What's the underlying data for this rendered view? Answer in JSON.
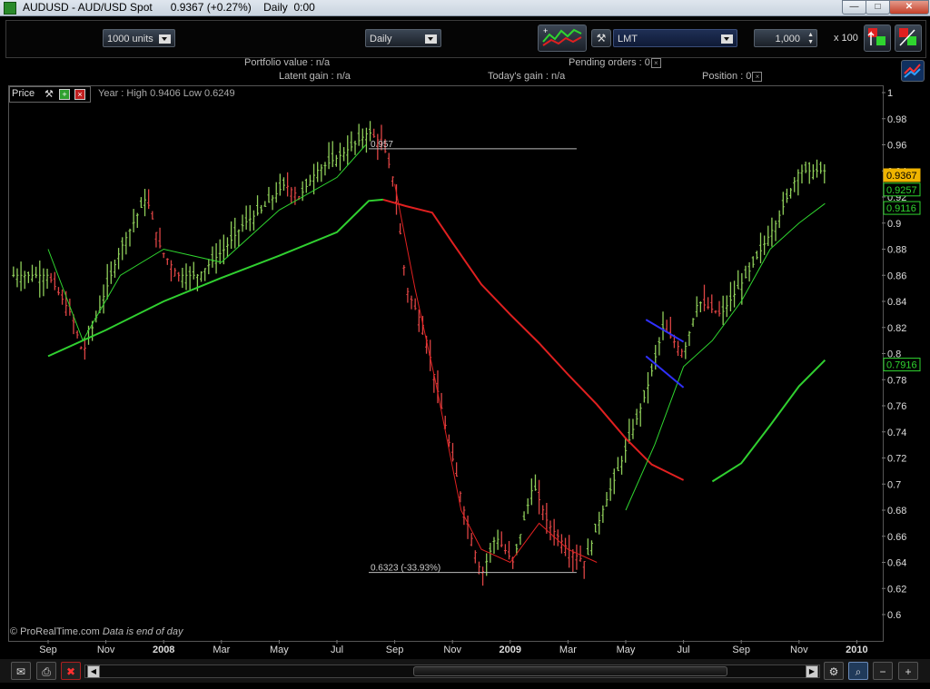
{
  "window": {
    "title": "AUDUSD - AUD/USD Spot      0.9367 (+0.27%)    Daily  0:00"
  },
  "toolbar": {
    "units_combo": "1000 units",
    "period_combo": "Daily",
    "order_type_combo": "LMT",
    "quantity_value": "1,000",
    "multiplier": "x 100"
  },
  "portfolio": {
    "portfolio_value": "Portfolio value : n/a",
    "latent_gain": "Latent gain : n/a",
    "todays_gain": "Today's gain : n/a",
    "pending_orders": "Pending orders : 0",
    "position": "Position : 0"
  },
  "chart_panel": {
    "label": "Price",
    "year_info": "Year : High 0.9406 Low 0.6249",
    "watermark": "© ProRealTime.com",
    "data_note": "Data is end of day",
    "line_high_label": "0.957",
    "line_low_label": "0.6323 (-33.93%)",
    "price_badges": [
      {
        "text": "0.9367",
        "color": "#f0b400",
        "value": 0.9367
      },
      {
        "text": "0.9257",
        "color": "#2fd52f",
        "value": 0.9257
      },
      {
        "text": "0.9116",
        "color": "#2fd52f",
        "value": 0.9116
      },
      {
        "text": "0.7916",
        "color": "#2fd52f",
        "value": 0.7916
      }
    ],
    "colors": {
      "up": "#4fd24f",
      "down": "#d23030",
      "ma_short": "#2fd52f",
      "ma_mid": "#e02020",
      "ma_long": "#30d030",
      "channel": "#3030ff"
    }
  },
  "chart_data": {
    "type": "line",
    "ylim": [
      0.6,
      1.0
    ],
    "y_ticks": [
      "1",
      "0.98",
      "0.96",
      "0.94",
      "0.92",
      "0.9",
      "0.88",
      "0.86",
      "0.84",
      "0.82",
      "0.8",
      "0.78",
      "0.76",
      "0.74",
      "0.72",
      "0.7",
      "0.68",
      "0.66",
      "0.64",
      "0.62",
      "0.6"
    ],
    "x_ticks": [
      "Sep",
      "Nov",
      "2008",
      "Mar",
      "May",
      "Jul",
      "Sep",
      "Nov",
      "2009",
      "Mar",
      "May",
      "Jul",
      "Sep",
      "Nov",
      "2010"
    ],
    "x_positions": [
      0,
      2,
      4,
      6,
      8,
      10,
      12,
      14,
      16,
      18,
      20,
      22,
      24,
      26,
      28
    ],
    "price": [
      0.86,
      0.83,
      0.8,
      0.83,
      0.88,
      0.92,
      0.88,
      0.86,
      0.86,
      0.88,
      0.9,
      0.91,
      0.93,
      0.92,
      0.94,
      0.95,
      0.96,
      0.97,
      0.96,
      0.93,
      0.85,
      0.82,
      0.77,
      0.68,
      0.63,
      0.66,
      0.64,
      0.7,
      0.67,
      0.65,
      0.64,
      0.68,
      0.72,
      0.77,
      0.82,
      0.8,
      0.84,
      0.83,
      0.86,
      0.9,
      0.94
    ],
    "price_x": [
      0,
      0.8,
      1.2,
      1.7,
      2.5,
      3.4,
      3.9,
      4.5,
      5.2,
      6.1,
      6.8,
      7.4,
      8.2,
      8.7,
      9.3,
      10.0,
      10.6,
      11.1,
      11.6,
      12.0,
      12.4,
      13.0,
      13.5,
      14.4,
      15.0,
      15.5,
      16.1,
      16.8,
      17.3,
      18.0,
      18.6,
      19.2,
      19.9,
      20.7,
      21.3,
      22.0,
      22.5,
      23.3,
      24.2,
      25.2,
      26.0
    ],
    "ma_long": [
      [
        0,
        0.798
      ],
      [
        2,
        0.818
      ],
      [
        4,
        0.84
      ],
      [
        6,
        0.858
      ],
      [
        8,
        0.875
      ],
      [
        10,
        0.893
      ],
      [
        11.1,
        0.917
      ],
      [
        11.6,
        0.918
      ],
      [
        12.4,
        0.913
      ],
      [
        13.3,
        0.908
      ],
      [
        14,
        0.885
      ],
      [
        15,
        0.853
      ],
      [
        16,
        0.83
      ],
      [
        17,
        0.808
      ],
      [
        18,
        0.784
      ],
      [
        19,
        0.761
      ],
      [
        20,
        0.735
      ],
      [
        20.9,
        0.715
      ],
      [
        22,
        0.703
      ],
      [
        23,
        0.702
      ],
      [
        24,
        0.716
      ],
      [
        25,
        0.745
      ],
      [
        26,
        0.775
      ],
      [
        26.9,
        0.795
      ]
    ],
    "ma_long_red_from": 11.6,
    "ma_long_red_to": 22.9,
    "ma_short": [
      [
        0,
        0.88
      ],
      [
        1.2,
        0.81
      ],
      [
        2.5,
        0.86
      ],
      [
        4,
        0.88
      ],
      [
        6,
        0.87
      ],
      [
        8,
        0.91
      ],
      [
        10,
        0.935
      ],
      [
        11,
        0.96
      ],
      [
        12,
        0.93
      ],
      [
        12.7,
        0.85
      ],
      [
        13.4,
        0.78
      ],
      [
        14.3,
        0.68
      ],
      [
        15,
        0.65
      ],
      [
        16,
        0.64
      ],
      [
        17,
        0.67
      ],
      [
        18,
        0.65
      ],
      [
        19,
        0.64
      ],
      [
        20,
        0.68
      ],
      [
        21,
        0.73
      ],
      [
        22,
        0.79
      ],
      [
        23,
        0.81
      ],
      [
        24,
        0.84
      ],
      [
        25,
        0.88
      ],
      [
        26,
        0.9
      ],
      [
        26.9,
        0.915
      ]
    ],
    "ma_short_red_from": 11.1,
    "ma_short_red_to": 19.2,
    "hline_high": {
      "value": 0.957,
      "x1": 11.1,
      "x2": 18.3
    },
    "hline_low": {
      "value": 0.6323,
      "x1": 11.1,
      "x2": 18.3
    },
    "channel": {
      "upper": [
        [
          20.7,
          0.826
        ],
        [
          22.0,
          0.809
        ]
      ],
      "lower": [
        [
          20.7,
          0.798
        ],
        [
          22.0,
          0.774
        ]
      ]
    },
    "grid": false,
    "legend": "none"
  },
  "statusbar": {
    "icons": [
      "mail-icon",
      "print-icon",
      "delete-icon"
    ],
    "right_icons": [
      "indicator-icon",
      "zoom-select-icon",
      "zoom-out-icon",
      "zoom-in-icon"
    ]
  }
}
